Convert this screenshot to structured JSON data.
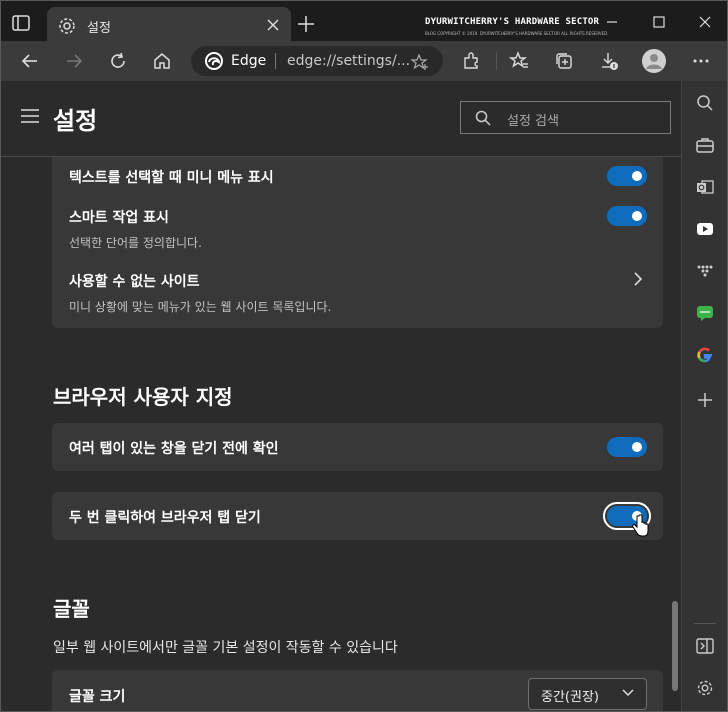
{
  "tabbar": {
    "tab_title": "설정",
    "watermark": "DYURWITCHERRY'S HARDWARE SECTOR",
    "watermark_sub": "BLOG COPYRIGHT © 2019. DYURWITCHERRY'S HARDWARE SECTOR ALL RIGHTS RESERVED."
  },
  "address_bar": {
    "brand": "Edge",
    "url": "edge://settings/..."
  },
  "page": {
    "title": "설정",
    "search_placeholder": "설정 검색"
  },
  "mini_menu_card": {
    "items": [
      {
        "label": "텍스트를 선택할 때 미니 메뉴 표시",
        "toggle_on": true
      },
      {
        "label": "스마트 작업 표시",
        "description": "선택한 단어를 정의합니다.",
        "toggle_on": true
      },
      {
        "label": "사용할 수 없는 사이트",
        "description": "미니 상황에 맞는 메뉴가 있는 웹 사이트 목록입니다."
      }
    ]
  },
  "browser_custom": {
    "title": "브라우저 사용자 지정",
    "items": [
      {
        "label": "여러 탭이 있는 창을 닫기 전에 확인",
        "toggle_on": true
      },
      {
        "label": "두 번 클릭하여 브라우저 탭 닫기",
        "toggle_on": true
      }
    ]
  },
  "fonts": {
    "title": "글꼴",
    "note": "일부 웹 사이트에서만 글꼴 기본 설정이 작동할 수 있습니다",
    "font_size_label": "글꼴 크기",
    "font_size_value": "중간(권장)"
  },
  "colors": {
    "accent": "#0f6cbd",
    "background": "#2b2b2b",
    "card": "#383838"
  }
}
